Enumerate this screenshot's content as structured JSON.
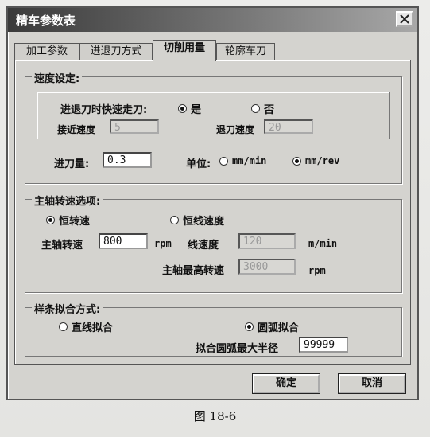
{
  "window": {
    "title": "精车参数表"
  },
  "tabs": [
    {
      "label": "加工参数",
      "active": false
    },
    {
      "label": "进退刀方式",
      "active": false
    },
    {
      "label": "切削用量",
      "active": true
    },
    {
      "label": "轮廓车刀",
      "active": false
    }
  ],
  "speed_setting": {
    "group_label": "速度设定:",
    "rapid_label": "进退刀时快速走刀:",
    "rapid_yes": "是",
    "rapid_no": "否",
    "rapid_selected": "yes",
    "approach_label": "接近速度",
    "approach_value": "5",
    "retract_label": "退刀速度",
    "retract_value": "20",
    "feed_label": "进刀量:",
    "feed_value": "0.3",
    "unit_label": "单位:",
    "unit_mm_min": "mm/min",
    "unit_mm_rev": "mm/rev",
    "unit_selected": "mm/rev"
  },
  "spindle": {
    "group_label": "主轴转速选项:",
    "constant_speed": "恒转速",
    "constant_linear": "恒线速度",
    "selected": "constant_speed",
    "spindle_speed_label": "主轴转速",
    "spindle_speed_value": "800",
    "spindle_unit": "rpm",
    "linear_speed_label": "线速度",
    "linear_speed_value": "120",
    "linear_unit": "m/min",
    "max_speed_label": "主轴最高转速",
    "max_speed_value": "3000",
    "max_unit": "rpm"
  },
  "spline": {
    "group_label": "样条拟合方式:",
    "line_fit": "直线拟合",
    "arc_fit": "圆弧拟合",
    "selected": "arc_fit",
    "max_radius_label": "拟合圆弧最大半径",
    "max_radius_value": "99999"
  },
  "buttons": {
    "ok": "确定",
    "cancel": "取消"
  },
  "caption": "图    18-6"
}
